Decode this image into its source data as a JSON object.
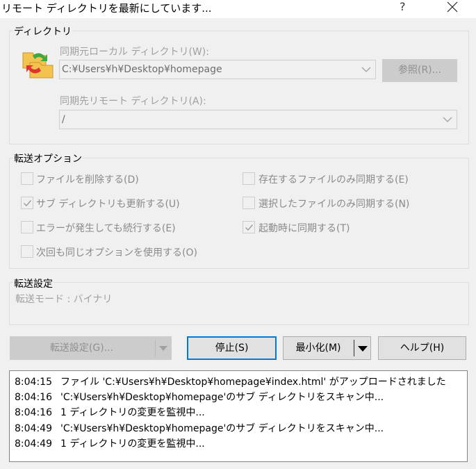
{
  "window": {
    "title": "リモート ディレクトリを最新にしています...",
    "help_glyph": "?"
  },
  "directory_group": {
    "label": "ディレクトリ",
    "local_label": "同期元ローカル ディレクトリ(W):",
    "local_value": "C:¥Users¥h¥Desktop¥homepage",
    "browse_label": "参照(R)...",
    "remote_label": "同期先リモート ディレクトリ(A):",
    "remote_value": "/"
  },
  "transfer_options": {
    "label": "転送オプション",
    "checkboxes": [
      {
        "label": "ファイルを削除する(D)",
        "checked": false
      },
      {
        "label": "サブ ディレクトリも更新する(U)",
        "checked": true
      },
      {
        "label": "エラーが発生しても続行する(E)",
        "checked": false
      },
      {
        "label": "次回も同じオプションを使用する(O)",
        "checked": false
      },
      {
        "label": "存在するファイルのみ同期する(E)",
        "checked": false
      },
      {
        "label": "選択したファイルのみ同期する(N)",
        "checked": false
      },
      {
        "label": "起動時に同期する(T)",
        "checked": true
      }
    ]
  },
  "transfer_settings": {
    "label": "転送設定",
    "mode_text": "転送モード : バイナリ"
  },
  "buttons": {
    "transfer_settings": "転送設定(G)...",
    "stop": "停止(S)",
    "minimize": "最小化(M)",
    "help": "ヘルプ(H)"
  },
  "log": [
    {
      "time": "8:04:15",
      "message": "ファイル 'C:¥Users¥h¥Desktop¥homepage¥index.html' がアップロードされました"
    },
    {
      "time": "8:04:16",
      "message": "'C:¥Users¥h¥Desktop¥homepage'のサブ ディレクトリをスキャン中..."
    },
    {
      "time": "8:04:16",
      "message": "1 ディレクトリの変更を監視中..."
    },
    {
      "time": "8:04:49",
      "message": "'C:¥Users¥h¥Desktop¥homepage'のサブ ディレクトリをスキャン中..."
    },
    {
      "time": "8:04:49",
      "message": "1 ディレクトリの変更を監視中..."
    }
  ],
  "icons": {
    "close": "close-icon",
    "folder_sync": "folder-sync-icon",
    "dropdown": "chevron-down-icon",
    "check": "checkmark-icon"
  },
  "colors": {
    "dialog_bg": "#f0f0f0",
    "focus_border": "#0078d7",
    "disabled_text": "#a0a0a0"
  }
}
